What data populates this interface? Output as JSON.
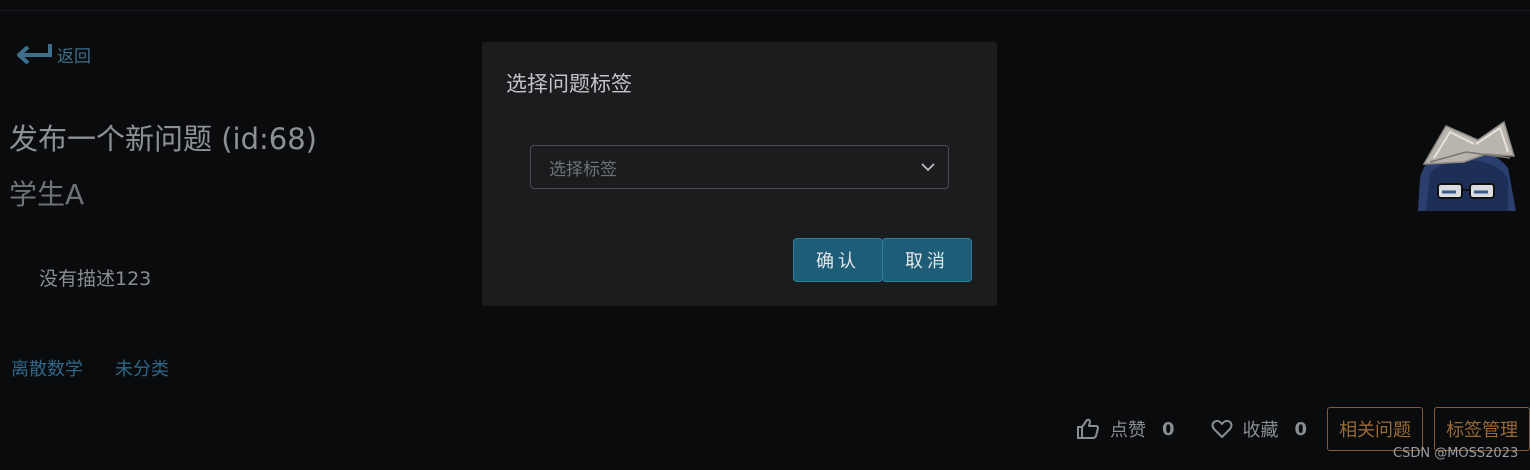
{
  "nav": {
    "back_label": "返回"
  },
  "question": {
    "title": "发布一个新问题 (id:68)",
    "author": "学生A",
    "description": "没有描述123",
    "tags": [
      "离散数学",
      "未分类"
    ]
  },
  "actions": {
    "like_label": "点赞",
    "like_count": "0",
    "favorite_label": "收藏",
    "favorite_count": "0",
    "related_button": "相关问题",
    "tag_manage_button": "标签管理"
  },
  "modal": {
    "title": "选择问题标签",
    "select_placeholder": "选择标签",
    "confirm_label": "确认",
    "cancel_label": "取消"
  },
  "watermark": "CSDN @MOSS2023",
  "icons": {
    "back": "return-arrow-icon",
    "like": "thumbs-up-icon",
    "favorite": "heart-icon",
    "dropdown": "chevron-down-icon",
    "avatar": "user-avatar"
  },
  "colors": {
    "background": "#0a0b0d",
    "modal_bg": "#1b1c1e",
    "link": "#2f678a",
    "primary_button": "#1d5d78",
    "outline_button": "#9a6a35"
  }
}
